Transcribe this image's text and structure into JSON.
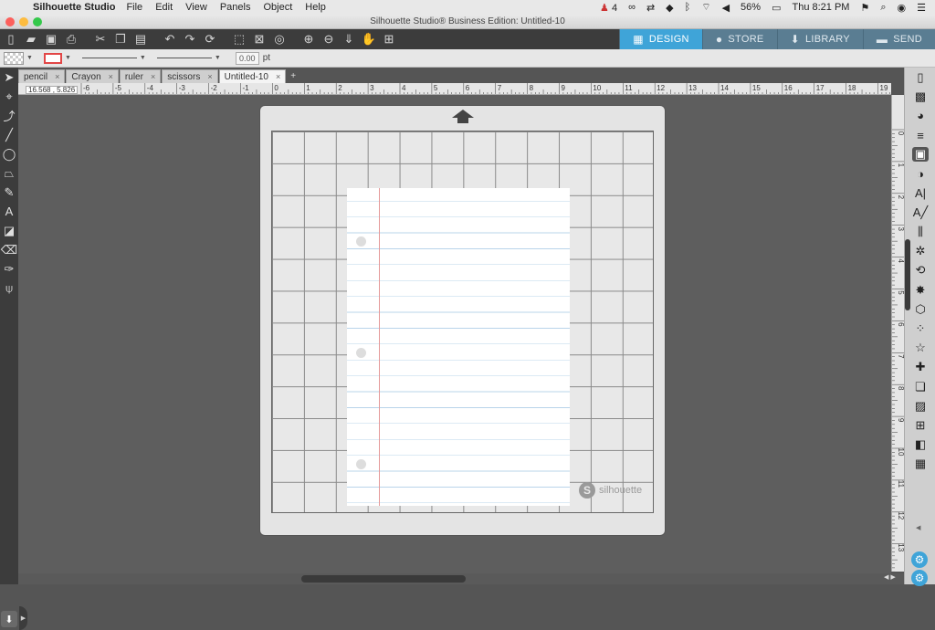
{
  "menubar": {
    "app_name": "Silhouette Studio",
    "items": [
      "File",
      "Edit",
      "View",
      "Panels",
      "Object",
      "Help"
    ],
    "notif_count": "4",
    "battery": "56%",
    "clock": "Thu 8:21 PM"
  },
  "window": {
    "title": "Silhouette Studio® Business Edition: Untitled-10"
  },
  "nav_tabs": [
    {
      "label": "DESIGN",
      "icon": "grid-icon",
      "active": true
    },
    {
      "label": "STORE",
      "icon": "silhouette-s-icon",
      "active": false
    },
    {
      "label": "LIBRARY",
      "icon": "library-icon",
      "active": false
    },
    {
      "label": "SEND",
      "icon": "cutter-icon",
      "active": false
    }
  ],
  "toolbar2": {
    "line_width": "0.00",
    "unit": "pt"
  },
  "doc_tabs": [
    {
      "label": "pencil",
      "active": false
    },
    {
      "label": "Crayon",
      "active": false
    },
    {
      "label": "ruler",
      "active": false
    },
    {
      "label": "scissors",
      "active": false
    },
    {
      "label": "Untitled-10",
      "active": true
    }
  ],
  "doc_tab_add": "+",
  "coord_readout": "16.568 , 5.826",
  "ruler": {
    "h_labels": [
      "-6",
      "-5",
      "-4",
      "-3",
      "-2",
      "-1",
      "0",
      "1",
      "2",
      "3",
      "4",
      "5",
      "6",
      "7",
      "8",
      "9",
      "10",
      "11",
      "12",
      "13",
      "14",
      "15",
      "16",
      "17",
      "18",
      "19"
    ],
    "v_labels": [
      "0",
      "1",
      "2",
      "3",
      "4",
      "5",
      "6",
      "7",
      "8",
      "9",
      "10",
      "11",
      "12",
      "13"
    ]
  },
  "mat": {
    "brand": "silhouette",
    "brand_mark": "S"
  },
  "colors": {
    "accent": "#3fa4d8",
    "toolbar_dark": "#3c3c3c",
    "canvas": "#5e5e5e",
    "margin_line": "#e59a9a",
    "rule_line": "#b9d4ea"
  }
}
